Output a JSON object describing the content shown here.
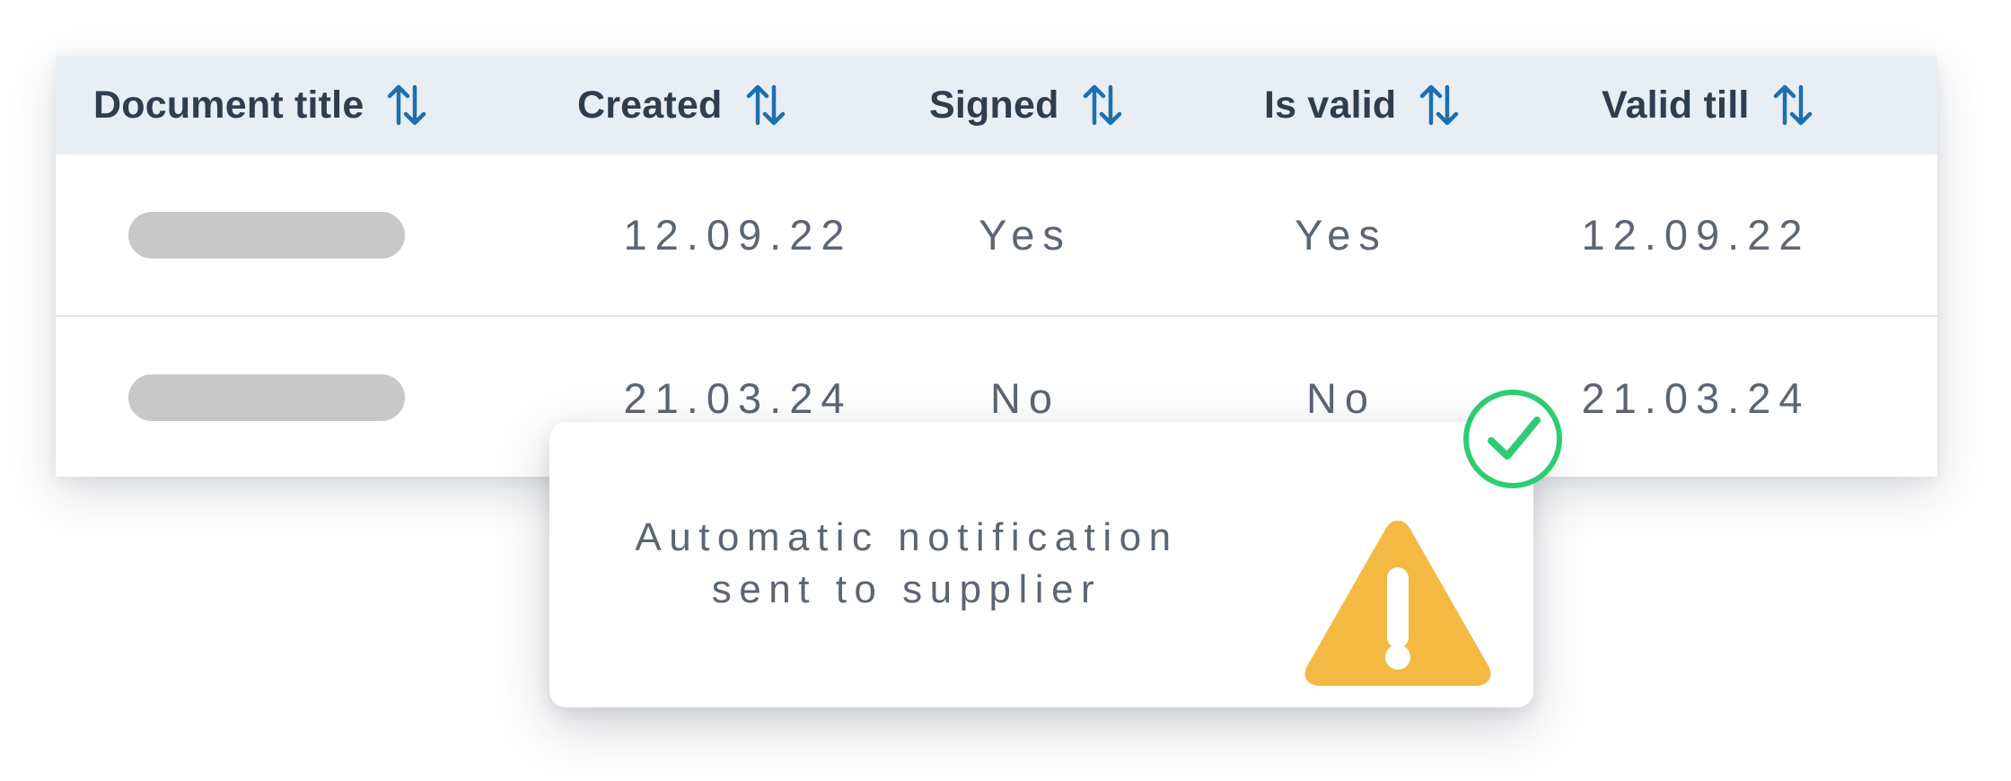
{
  "table": {
    "columns": [
      {
        "label": "Document title",
        "icon": "sort-arrows-icon"
      },
      {
        "label": "Created",
        "icon": "sort-arrows-icon"
      },
      {
        "label": "Signed",
        "icon": "sort-arrows-icon"
      },
      {
        "label": "Is valid",
        "icon": "sort-arrows-icon"
      },
      {
        "label": "Valid till",
        "icon": "sort-arrows-icon"
      }
    ],
    "rows": [
      {
        "title": "",
        "created": "12.09.22",
        "signed": "Yes",
        "is_valid": "Yes",
        "valid_till": "12.09.22"
      },
      {
        "title": "",
        "created": "21.03.24",
        "signed": "No",
        "is_valid": "No",
        "valid_till": "21.03.24"
      }
    ]
  },
  "notification": {
    "line1": "Automatic notification",
    "line2": "sent to supplier",
    "icon": "warning-icon",
    "badge_icon": "check-circle-icon"
  },
  "colors": {
    "header_bg": "#e9eef5",
    "header_text": "#2f3d4e",
    "sort_icon": "#1d6fb0",
    "cell_text": "#5b6574",
    "redacted": "#c8c8c8",
    "warning": "#f4b942",
    "success": "#2ecc71"
  }
}
